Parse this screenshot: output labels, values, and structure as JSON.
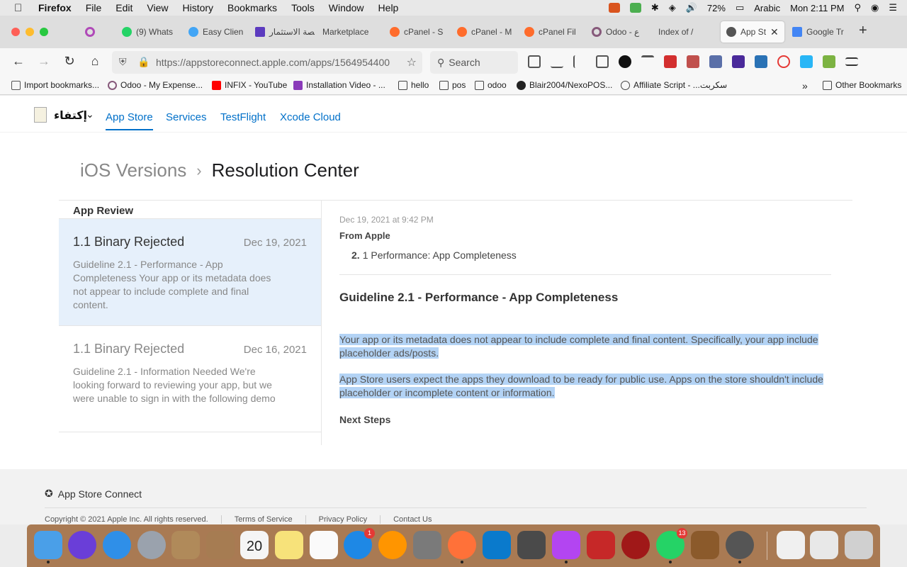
{
  "menubar": {
    "app_name": "Firefox",
    "items": [
      "File",
      "Edit",
      "View",
      "History",
      "Bookmarks",
      "Tools",
      "Window",
      "Help"
    ],
    "battery": "72%",
    "input_source": "Arabic",
    "clock": "Mon 2:11 PM"
  },
  "tabs": [
    {
      "label": "",
      "color": "#b04ab8"
    },
    {
      "label": "(9) Whats",
      "color": "#25d366"
    },
    {
      "label": "Easy Clien",
      "color": "#42a5f5"
    },
    {
      "label": "منصة الاستثمار",
      "color": "#5c3bbf"
    },
    {
      "label": "Marketplace",
      "color": "#cccccc"
    },
    {
      "label": "cPanel - S",
      "color": "#ff6c2c"
    },
    {
      "label": "cPanel - M",
      "color": "#ff6c2c"
    },
    {
      "label": "cPanel Fil",
      "color": "#ff6c2c"
    },
    {
      "label": "Odoo - ع",
      "color": "#875a7b"
    },
    {
      "label": "Index of /",
      "color": "#cccccc"
    },
    {
      "label": "App St",
      "color": "#555555",
      "active": true
    },
    {
      "label": "Google Tr",
      "color": "#4285f4"
    }
  ],
  "navbar": {
    "url": "https://appstoreconnect.apple.com/apps/1564954400",
    "search_placeholder": "Search"
  },
  "bookmarks": [
    {
      "label": "Import bookmarks...",
      "color": "#555555"
    },
    {
      "label": "Odoo - My Expense...",
      "color": "#875a7b"
    },
    {
      "label": "INFIX - YouTube",
      "color": "#ff0000"
    },
    {
      "label": "Installation Video - ...",
      "color": "#8a3ab9"
    },
    {
      "label": "hello",
      "color": "#888888"
    },
    {
      "label": "pos",
      "color": "#888888"
    },
    {
      "label": "odoo",
      "color": "#888888"
    },
    {
      "label": "Blair2004/NexoPOS...",
      "color": "#222222"
    },
    {
      "label": "Affiliate Script - ...سكربت",
      "color": "#444444"
    }
  ],
  "bookmarks_other": "Other Bookmarks",
  "appnav": {
    "app_name": "إكتفاء",
    "links": [
      "App Store",
      "Services",
      "TestFlight",
      "Xcode Cloud"
    ]
  },
  "breadcrumb": {
    "parent": "iOS Versions",
    "current": "Resolution Center"
  },
  "review": {
    "title": "App Review",
    "messages": [
      {
        "title": "1.1 Binary Rejected",
        "date": "Dec 19, 2021",
        "body": "Guideline 2.1 - Performance - App Completeness Your app or its metadata does not appear to include complete and final content."
      },
      {
        "title": "1.1 Binary Rejected",
        "date": "Dec 16, 2021",
        "body": "Guideline 2.1 - Information Needed We're looking forward to reviewing your app, but we were unable to sign in with the following demo"
      }
    ]
  },
  "detail": {
    "timestamp": "Dec 19, 2021 at 9:42 PM",
    "from": "From Apple",
    "item_num": "2.",
    "item_text": "1 Performance: App Completeness",
    "heading": "Guideline 2.1 - Performance - App Completeness",
    "para1": "Your app or its metadata does not appear to include complete and final content. Specifically, your app include placeholder ads/posts.",
    "para2": "App Store users expect the apps they download to be ready for public use. Apps on the store shouldn't include placeholder or incomplete content or information.",
    "next_steps": "Next Steps"
  },
  "footer": {
    "brand": "App Store Connect",
    "copyright": "Copyright © 2021 Apple Inc. All rights reserved.",
    "terms": "Terms of Service",
    "privacy": "Privacy Policy",
    "contact": "Contact Us"
  },
  "dock": [
    {
      "name": "Finder",
      "color": "#4a9fe8"
    },
    {
      "name": "Siri",
      "color": "#6a3ed8"
    },
    {
      "name": "Safari",
      "color": "#2f8fe8"
    },
    {
      "name": "Launchpad",
      "color": "#9aa2ad"
    },
    {
      "name": "Mail",
      "color": "#b08a5a"
    },
    {
      "name": "Contacts",
      "color": "#a67c52"
    },
    {
      "name": "Calendar",
      "color": "#f5f5f5",
      "text": "20"
    },
    {
      "name": "Notes",
      "color": "#f7e27a"
    },
    {
      "name": "Reminders",
      "color": "#fafafa"
    },
    {
      "name": "App Store",
      "color": "#1e88e5",
      "badge": "1"
    },
    {
      "name": "Books",
      "color": "#ff9500"
    },
    {
      "name": "System Preferences",
      "color": "#7a7a7a"
    },
    {
      "name": "Firefox",
      "color": "#ff7139"
    },
    {
      "name": "VS Code",
      "color": "#0a7acc"
    },
    {
      "name": "Sublime Text",
      "color": "#4a4a4a"
    },
    {
      "name": "PhpStorm",
      "color": "#b345f1"
    },
    {
      "name": "FileZilla",
      "color": "#c62828"
    },
    {
      "name": "Pin",
      "color": "#a01818"
    },
    {
      "name": "WhatsApp",
      "color": "#25d366",
      "badge": "13"
    },
    {
      "name": "Broom",
      "color": "#8b5a2b"
    },
    {
      "name": "Sequel Pro",
      "color": "#555555"
    },
    {
      "name": "Document",
      "color": "#f0f0f0"
    },
    {
      "name": "Screenshot",
      "color": "#e8e8e8"
    },
    {
      "name": "Trash",
      "color": "#d0d0d0"
    }
  ]
}
